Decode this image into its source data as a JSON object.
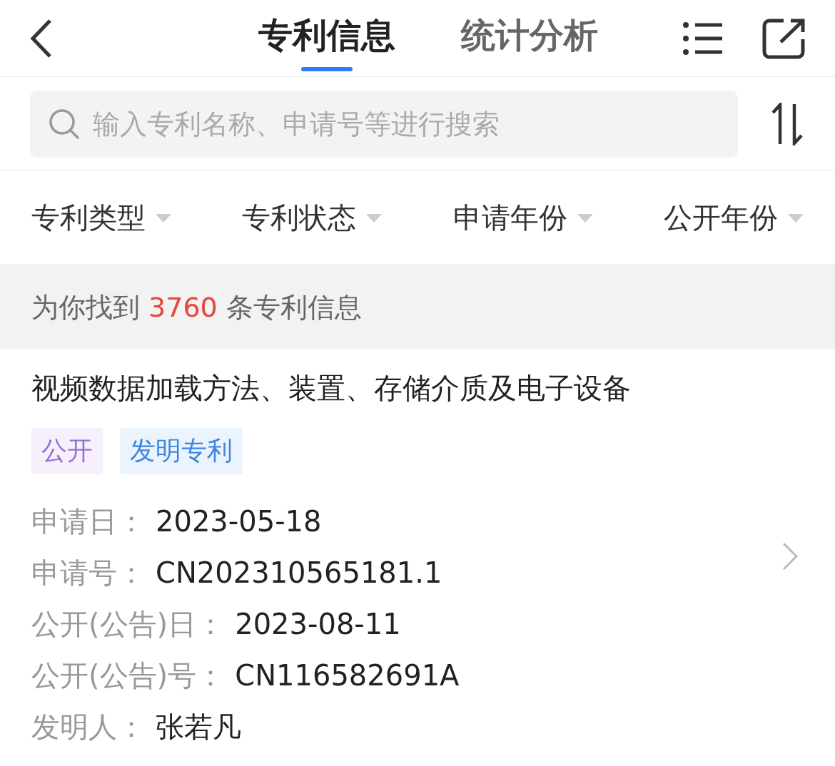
{
  "header": {
    "tabs": [
      {
        "label": "专利信息",
        "selected": true
      },
      {
        "label": "统计分析",
        "selected": false
      }
    ]
  },
  "search": {
    "placeholder": "输入专利名称、申请号等进行搜索"
  },
  "filters": [
    {
      "label": "专利类型"
    },
    {
      "label": "专利状态"
    },
    {
      "label": "申请年份"
    },
    {
      "label": "公开年份"
    }
  ],
  "result_count": {
    "prefix": "为你找到",
    "count": "3760",
    "suffix": "条专利信息"
  },
  "patents": [
    {
      "title": "视频数据加载方法、装置、存储介质及电子设备",
      "tags": [
        {
          "label": "公开",
          "color": "#9a6fd6"
        },
        {
          "label": "发明专利",
          "color": "#3d86e0"
        }
      ],
      "fields": [
        {
          "label": "申请日：",
          "value": "2023-05-18"
        },
        {
          "label": "申请号：",
          "value": "CN202310565181.1"
        },
        {
          "label": "公开(公告)日：",
          "value": "2023-08-11"
        },
        {
          "label": "公开(公告)号：",
          "value": "CN116582691A"
        },
        {
          "label": "发明人：",
          "value": "张若凡"
        }
      ]
    }
  ]
}
